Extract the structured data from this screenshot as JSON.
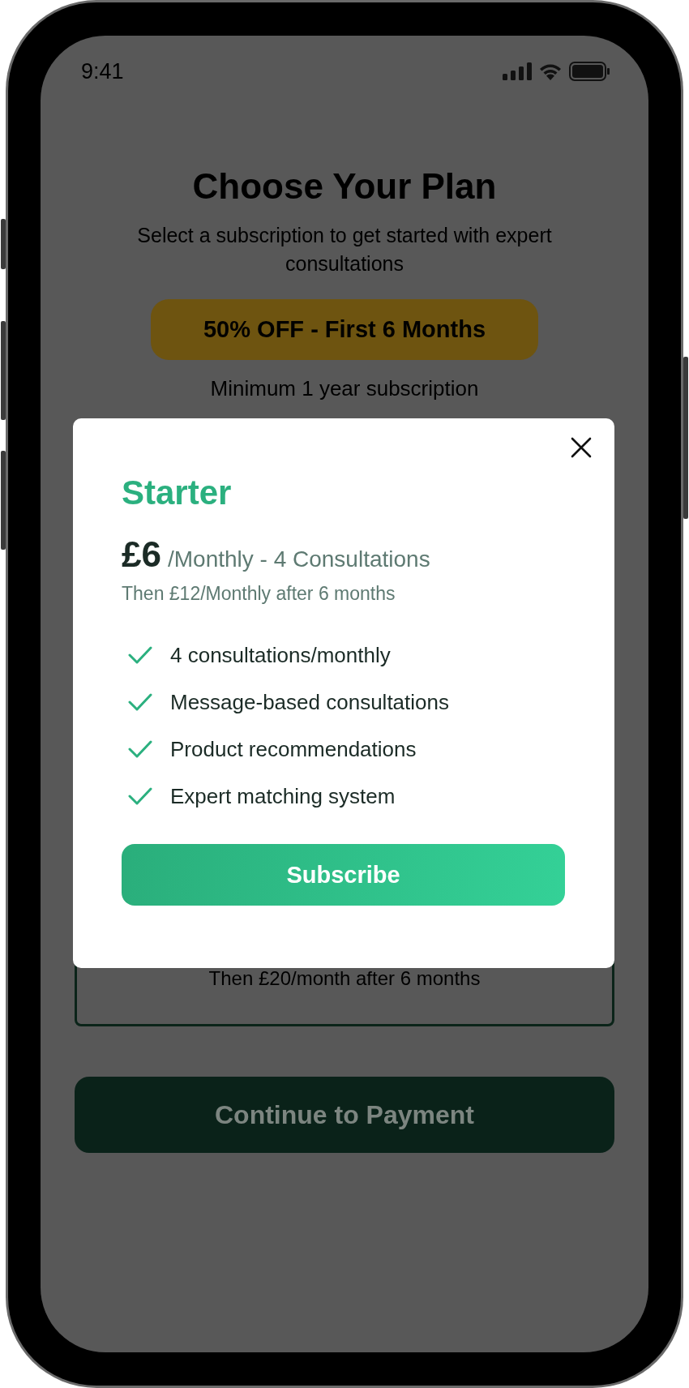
{
  "status_bar": {
    "time": "9:41"
  },
  "header": {
    "title": "Choose Your Plan",
    "subtitle": "Select a subscription to get started with expert consultations",
    "badge": "50% OFF - First 6 Months",
    "note": "Minimum 1 year subscription"
  },
  "background_card": {
    "text": "Then £20/month after 6 months"
  },
  "continue_button": {
    "label": "Continue to Payment"
  },
  "modal": {
    "plan": "Starter",
    "price": "£6",
    "period": "/Monthly - 4 Consultations",
    "after_text": "Then £12/Monthly after 6 months",
    "features": [
      "4 consultations/monthly",
      "Message-based consultations",
      "Product recommendations",
      "Expert matching system"
    ],
    "button": "Subscribe"
  }
}
